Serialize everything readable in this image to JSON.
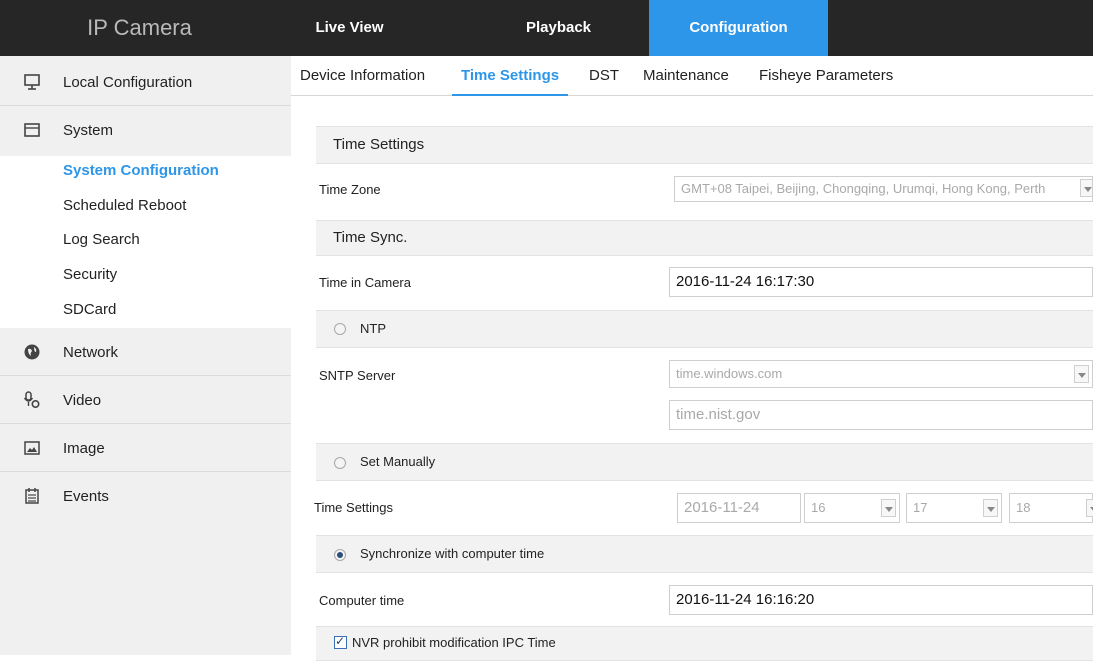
{
  "app": {
    "title": "IP Camera"
  },
  "topnav": {
    "tabs": [
      "Live View",
      "Playback",
      "Configuration"
    ],
    "active": "Configuration"
  },
  "sidebar": {
    "items": [
      {
        "label": "Local Configuration",
        "icon": "monitor-icon"
      },
      {
        "label": "System",
        "icon": "window-icon"
      },
      {
        "label": "Network",
        "icon": "globe-icon"
      },
      {
        "label": "Video",
        "icon": "microphone-icon"
      },
      {
        "label": "Image",
        "icon": "image-icon"
      },
      {
        "label": "Events",
        "icon": "calendar-icon"
      }
    ],
    "system_subitems": [
      "System Configuration",
      "Scheduled Reboot",
      "Log Search",
      "Security",
      "SDCard"
    ],
    "active_subitem": "System Configuration"
  },
  "tabs": {
    "items": [
      "Device Information",
      "Time Settings",
      "DST",
      "Maintenance",
      "Fisheye Parameters"
    ],
    "active": "Time Settings"
  },
  "form": {
    "time_settings_title": "Time Settings",
    "time_zone_label": "Time Zone",
    "time_zone_value": "GMT+08 Taipei, Beijing, Chongqing, Urumqi, Hong Kong, Perth",
    "time_sync_title": "Time Sync.",
    "time_in_camera_label": "Time in Camera",
    "time_in_camera_value": "2016-11-24 16:17:30",
    "ntp_label": "NTP",
    "sntp_server_label": "SNTP Server",
    "sntp_server_value": "time.windows.com",
    "sntp_server_custom": "time.nist.gov",
    "set_manually_label": "Set Manually",
    "manual_time_label": "Time Settings",
    "manual_date": "2016-11-24",
    "manual_hour": "16",
    "manual_minute": "17",
    "manual_second": "18",
    "sync_computer_label": "Synchronize with computer time",
    "computer_time_label": "Computer time",
    "computer_time_value": "2016-11-24 16:16:20",
    "nvr_prohibit_label": "NVR prohibit modification IPC Time",
    "selected_mode": "Synchronize with computer time",
    "nvr_prohibit_checked": true
  },
  "colors": {
    "accent": "#2e96e8",
    "topbar": "#262626",
    "sidebar": "#f0f0f0"
  }
}
